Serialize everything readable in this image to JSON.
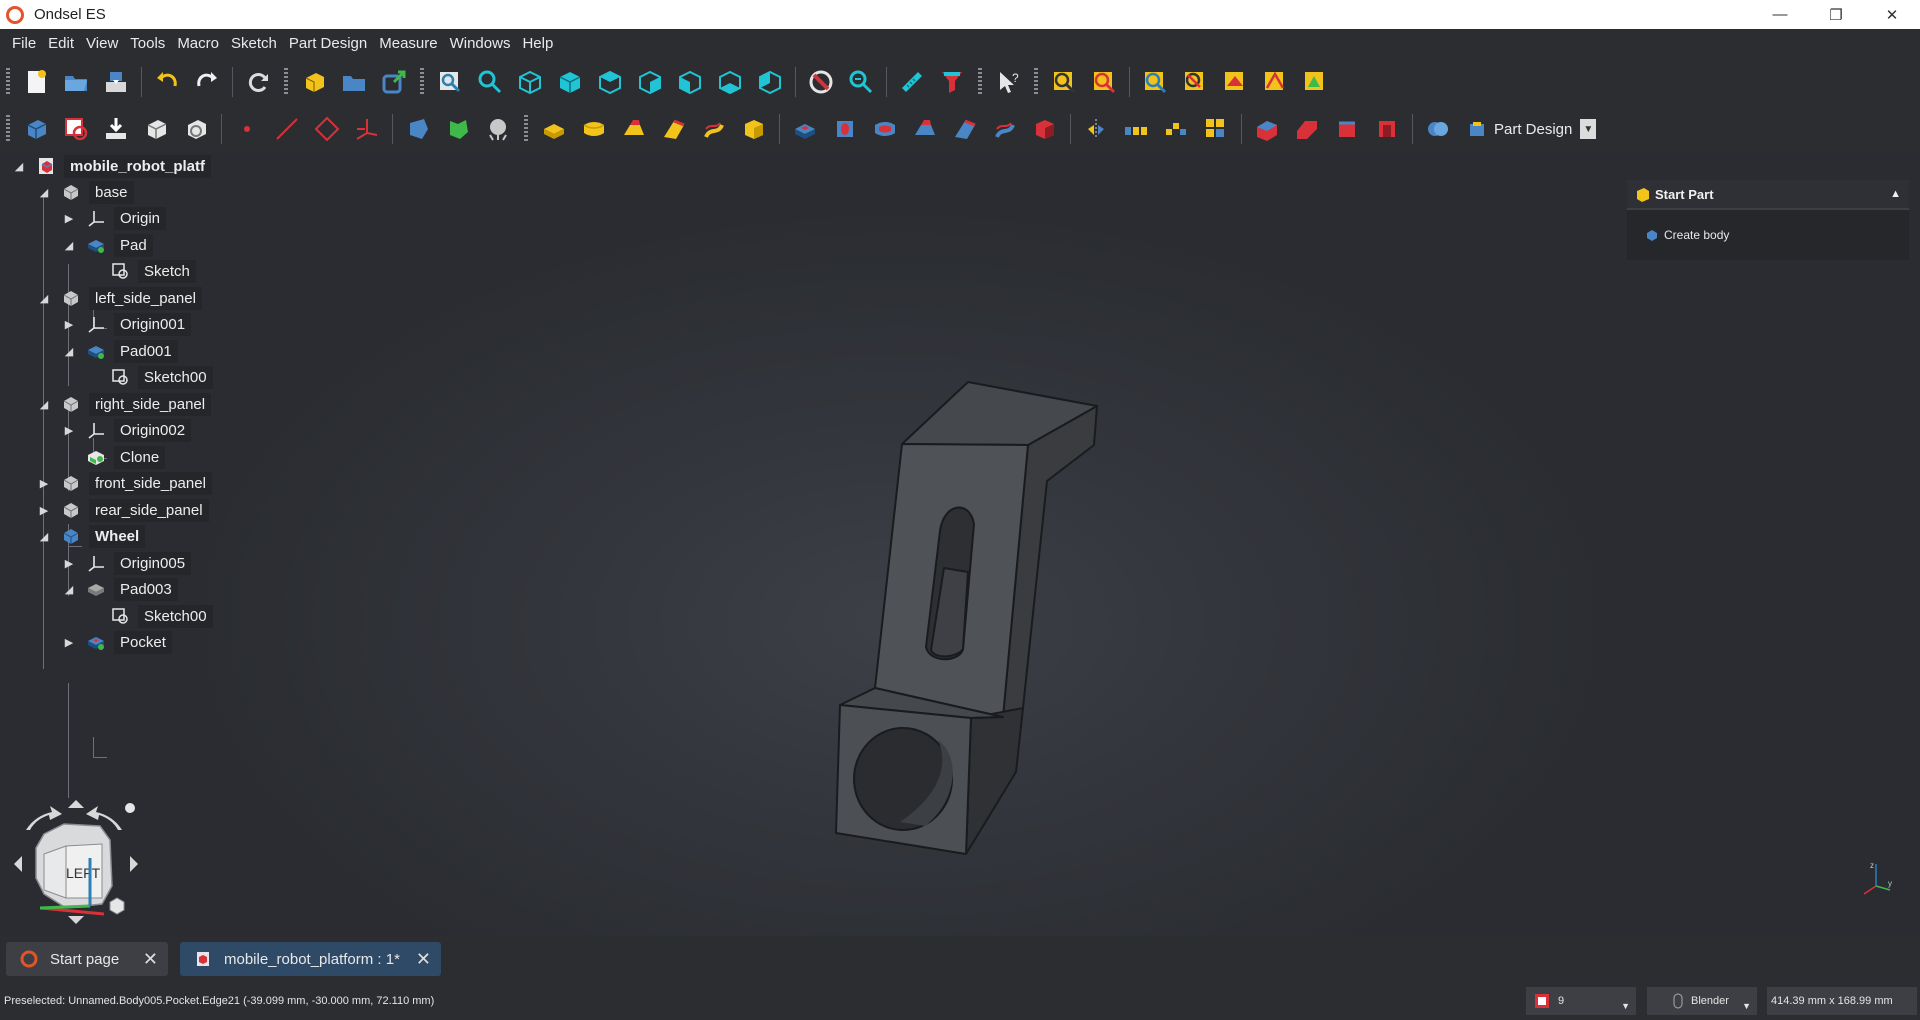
{
  "window": {
    "title": "Ondsel ES",
    "buttons": [
      "minimize",
      "restore",
      "close"
    ]
  },
  "menu": {
    "items": [
      "File",
      "Edit",
      "View",
      "Tools",
      "Macro",
      "Sketch",
      "Part Design",
      "Measure",
      "Windows",
      "Help"
    ]
  },
  "toolbar": {
    "workbench_label": "Part Design"
  },
  "tree": {
    "items": [
      {
        "label": "mobile_robot_platf",
        "icon": "document-icon"
      },
      {
        "label": "base",
        "icon": "body-icon"
      },
      {
        "label": "Origin",
        "icon": "origin-icon"
      },
      {
        "label": "Pad",
        "icon": "pad-icon"
      },
      {
        "label": "Sketch",
        "icon": "sketch-icon"
      },
      {
        "label": "left_side_panel",
        "icon": "body-icon"
      },
      {
        "label": "Origin001",
        "icon": "origin-icon"
      },
      {
        "label": "Pad001",
        "icon": "pad-icon"
      },
      {
        "label": "Sketch00",
        "icon": "sketch-icon"
      },
      {
        "label": "right_side_panel",
        "icon": "body-icon"
      },
      {
        "label": "Origin002",
        "icon": "origin-icon"
      },
      {
        "label": "Clone",
        "icon": "clone-icon"
      },
      {
        "label": "front_side_panel",
        "icon": "body-icon"
      },
      {
        "label": "rear_side_panel",
        "icon": "body-icon"
      },
      {
        "label": "Wheel",
        "icon": "active-body-icon"
      },
      {
        "label": "Origin005",
        "icon": "origin-icon"
      },
      {
        "label": "Pad003",
        "icon": "pad-gray-icon"
      },
      {
        "label": "Sketch00",
        "icon": "sketch-icon"
      },
      {
        "label": "Pocket",
        "icon": "pocket-icon"
      }
    ]
  },
  "navcube": {
    "face_label": "LEFT"
  },
  "task_panel": {
    "header": "Start Part",
    "action": "Create body"
  },
  "tabs": [
    {
      "label": "Start page",
      "active": false
    },
    {
      "label": "mobile_robot_platform : 1*",
      "active": true
    }
  ],
  "status": {
    "preselected": "Preselected: Unnamed.Body005.Pocket.Edge21 (-39.099 mm, -30.000 mm, 72.110 mm)",
    "count": "9",
    "navigation_style": "Blender",
    "dimensions": "414.39 mm x 168.99 mm"
  },
  "colors": {
    "accent": "#e2542a",
    "background": "#2b2d31",
    "active_tab": "#2f4a66",
    "part_fill": "#4a4d52"
  }
}
